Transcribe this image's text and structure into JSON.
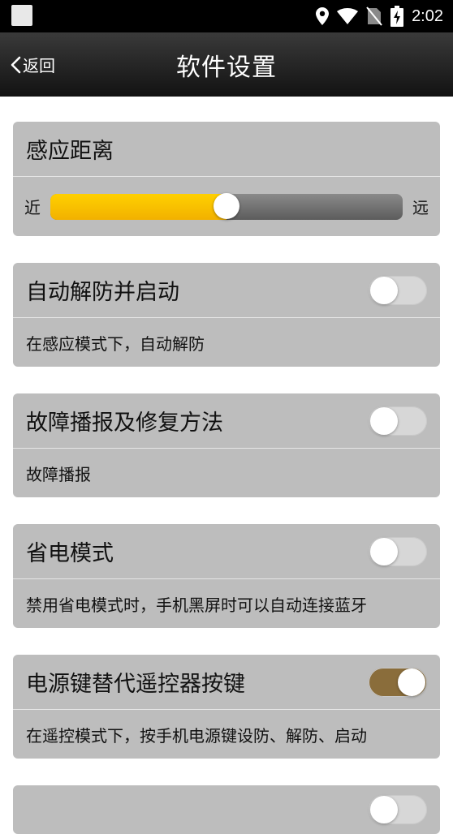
{
  "status_bar": {
    "time": "2:02",
    "icons": [
      "notification-icon",
      "location-icon",
      "wifi-icon",
      "no-sim-icon",
      "battery-charging-icon"
    ]
  },
  "header": {
    "back_label": "返回",
    "title": "软件设置"
  },
  "sensing_distance": {
    "title": "感应距离",
    "near_label": "近",
    "far_label": "远",
    "value_fraction": 0.5
  },
  "settings": [
    {
      "title": "自动解防并启动",
      "description": "在感应模式下，自动解防",
      "enabled": false
    },
    {
      "title": "故障播报及修复方法",
      "description": "故障播报",
      "enabled": false
    },
    {
      "title": "省电模式",
      "description": "禁用省电模式时，手机黑屏时可以自动连接蓝牙",
      "enabled": false
    },
    {
      "title": "电源键替代遥控器按键",
      "description": "在遥控模式下，按手机电源键设防、解防、启动",
      "enabled": true
    }
  ],
  "colors": {
    "card_bg": "#bdbdbd",
    "toggle_on": "#8a6d3b",
    "slider_fill": "#f7c000"
  }
}
